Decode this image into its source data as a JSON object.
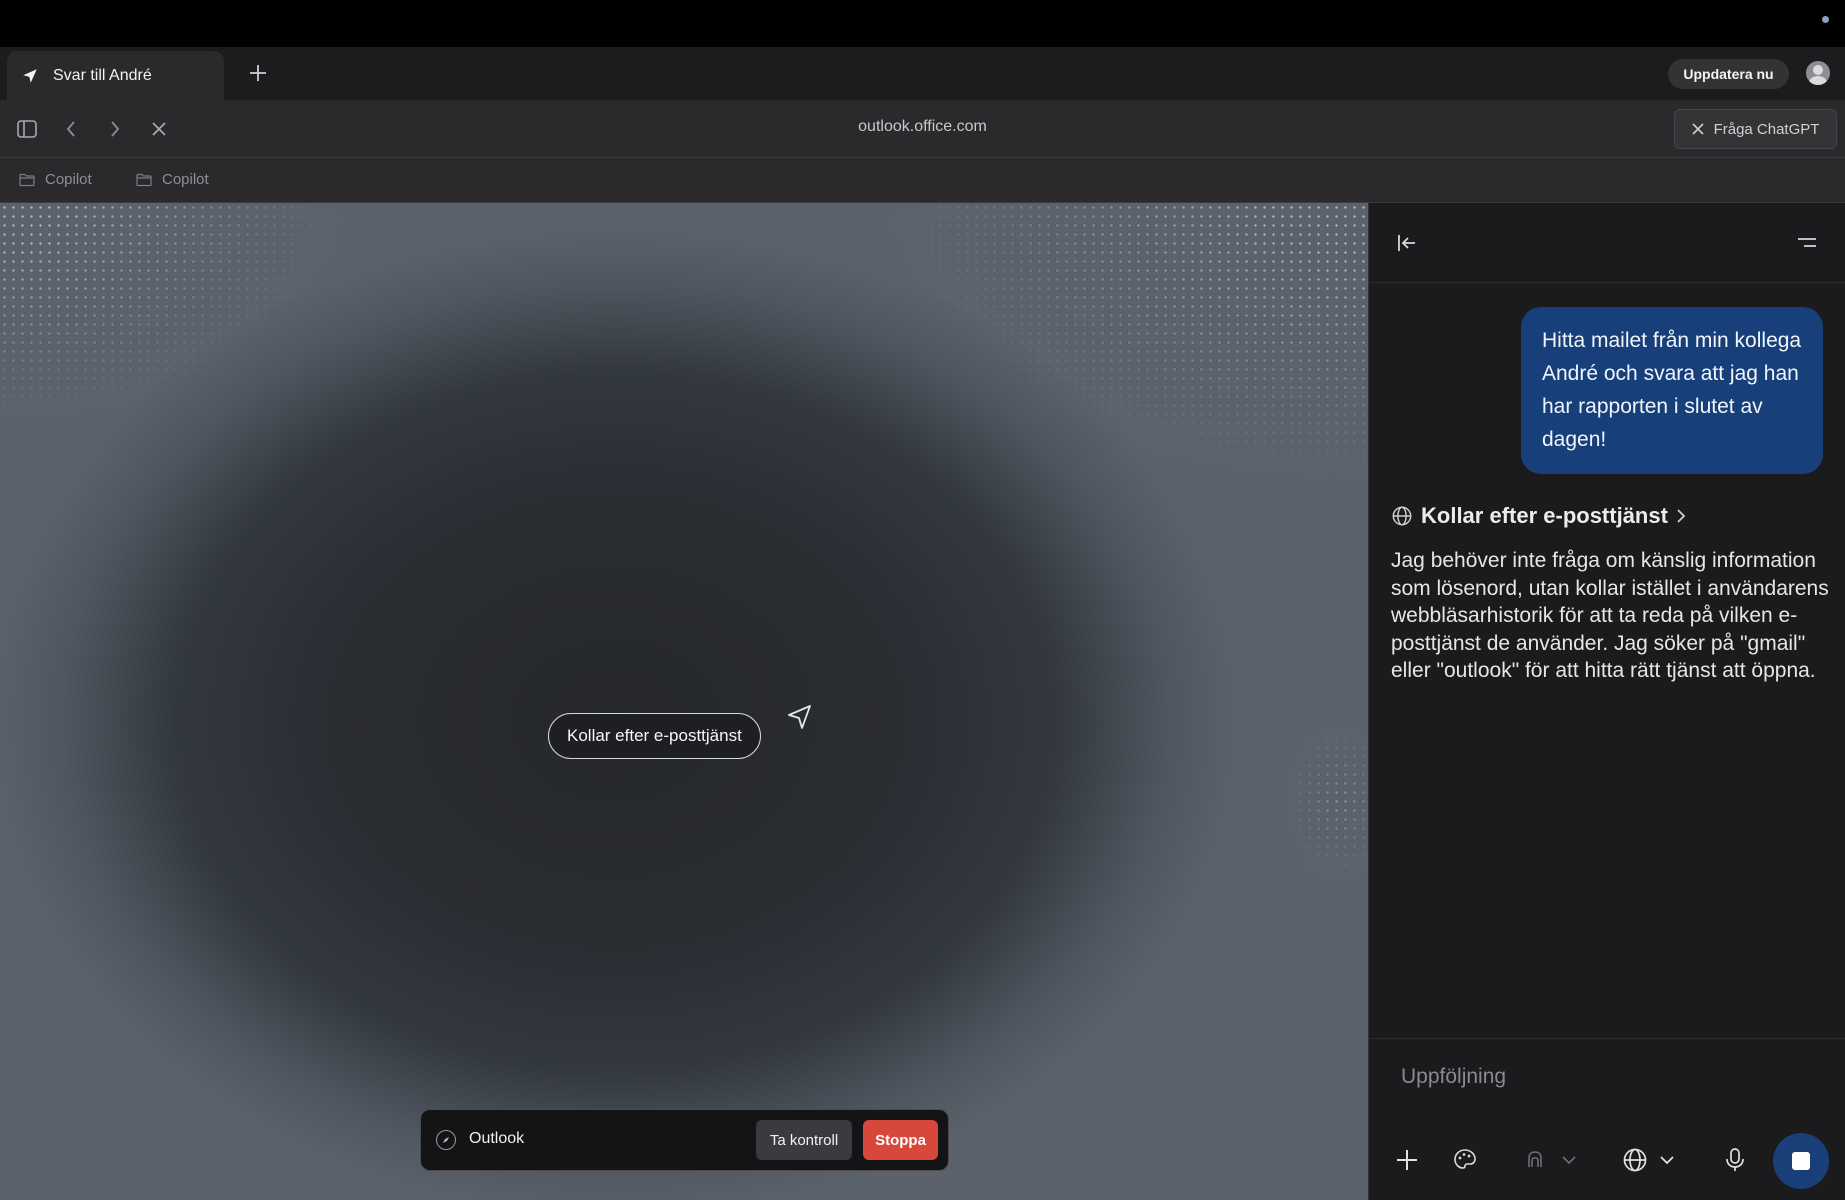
{
  "tab": {
    "title": "Svar till André",
    "icon": "navigation-arrow-icon"
  },
  "toolbar": {
    "new_tab_icon": "plus-icon",
    "update_label": "Uppdatera nu"
  },
  "address": {
    "url": "outlook.office.com",
    "ask_label": "Fråga ChatGPT"
  },
  "bookmarks": [
    {
      "label": "Copilot",
      "icon": "folder-icon"
    },
    {
      "label": "Copilot",
      "icon": "folder-icon"
    }
  ],
  "viewport": {
    "status_pill": "Kollar efter e-posttjänst",
    "control_bar": {
      "site_label": "Outlook",
      "take_control_label": "Ta kontroll",
      "stop_label": "Stoppa"
    }
  },
  "panel": {
    "user_message": "Hitta mailet från min kollega André och svara att jag han har rapporten i slutet av dagen!",
    "step_title": "Kollar efter e-posttjänst",
    "assistant_text": "Jag behöver inte fråga om känslig information som lösenord, utan kollar istället i användarens webbläsarhistorik för att ta reda på vilken e-posttjänst de använder. Jag söker på \"gmail\" eller \"outlook\" för att hitta rätt tjänst att öppna.",
    "composer_placeholder": "Uppföljning"
  },
  "colors": {
    "user_bubble": "#173f7a",
    "stop_button": "#d8473b",
    "send_stop": "#1a3f78"
  }
}
